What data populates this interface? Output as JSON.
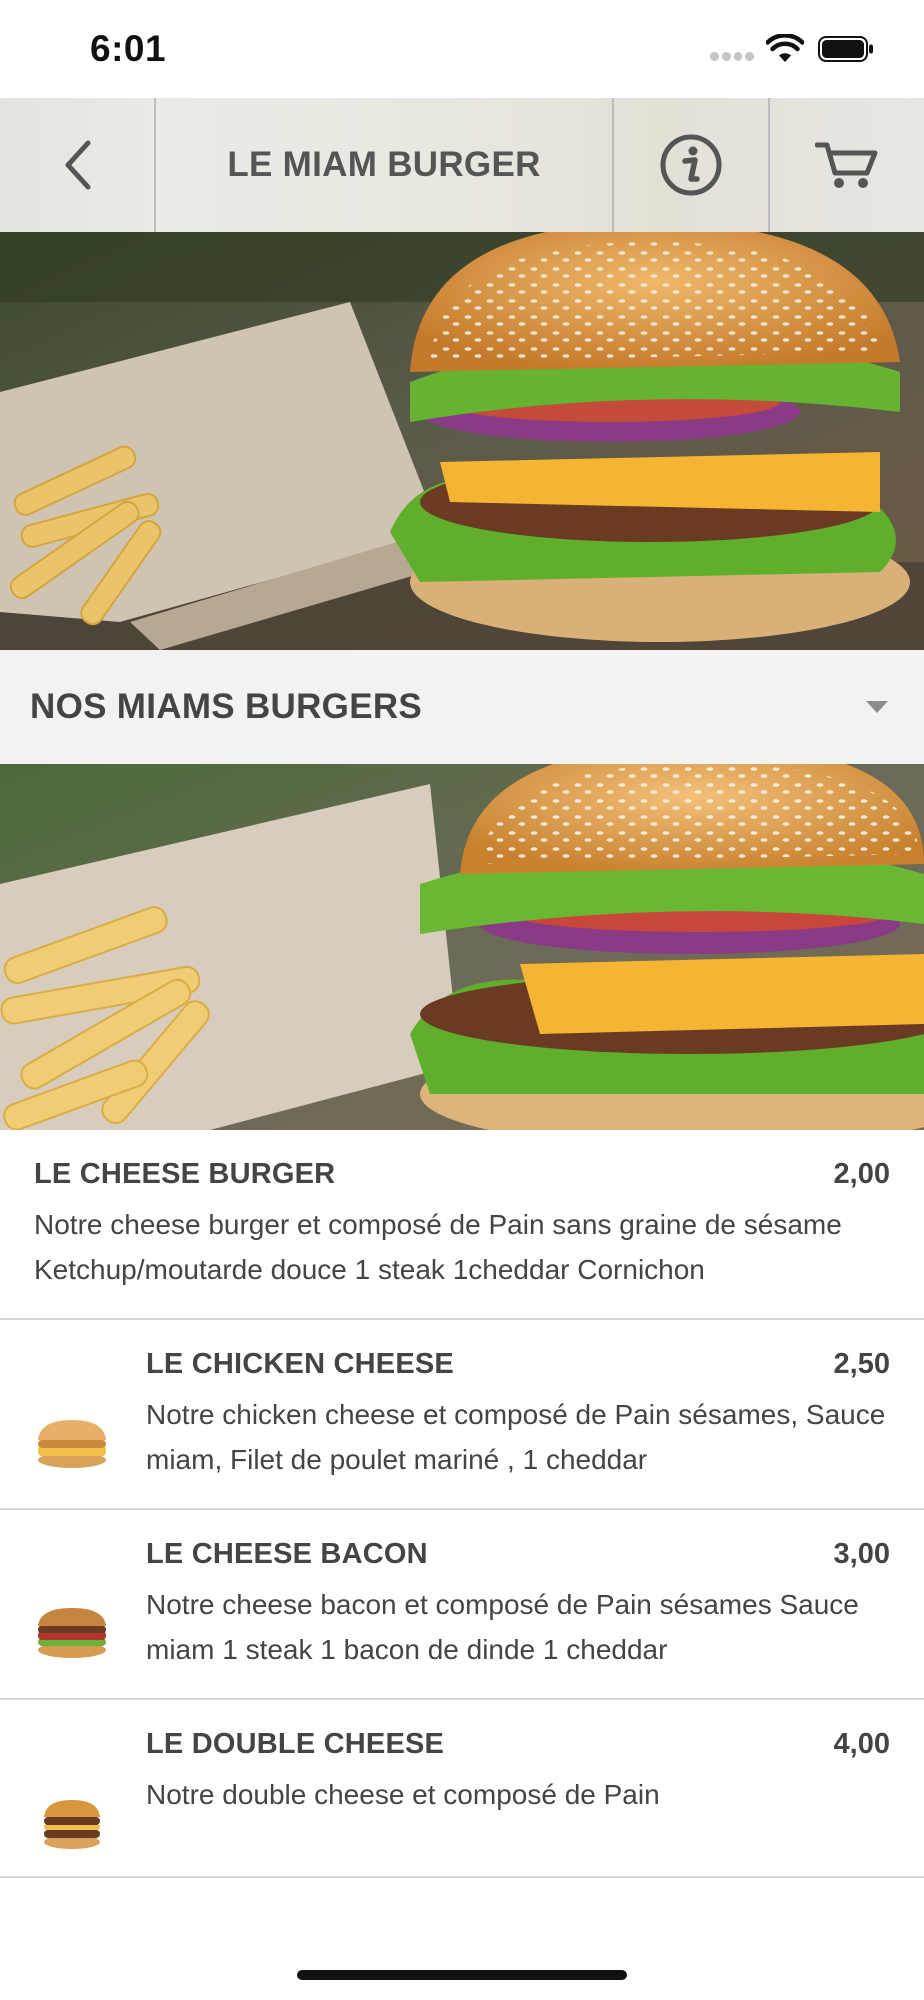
{
  "status_bar": {
    "time": "6:01"
  },
  "nav": {
    "title": "LE MIAM BURGER"
  },
  "category": {
    "title": "NOS MIAMS BURGERS"
  },
  "items": [
    {
      "name": "LE CHEESE BURGER",
      "price": "2,00",
      "description": "Notre cheese burger et composé de Pain sans graine de sésame Ketchup/moutarde douce 1 steak 1cheddar Cornichon"
    },
    {
      "name": "LE CHICKEN CHEESE",
      "price": "2,50",
      "description": "Notre chicken cheese et composé de Pain sésames, Sauce miam, Filet de poulet mariné , 1 cheddar"
    },
    {
      "name": "LE CHEESE BACON",
      "price": "3,00",
      "description": "Notre cheese bacon et composé de Pain sésames Sauce miam 1 steak 1 bacon de dinde 1 cheddar"
    },
    {
      "name": "LE DOUBLE CHEESE",
      "price": "4,00",
      "description": "Notre double cheese et composé de Pain"
    }
  ],
  "icons": {
    "back": "chevron-left-icon",
    "info": "info-icon",
    "cart": "cart-icon"
  },
  "colors": {
    "text": "#444444",
    "nav_title": "#555555",
    "category_bg": "#f2f2f2"
  }
}
